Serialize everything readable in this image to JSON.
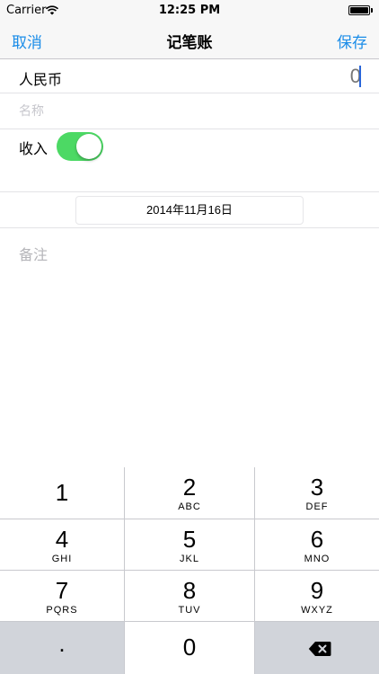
{
  "status_bar": {
    "carrier": "Carrier",
    "time": "12:25 PM",
    "icons": [
      "wifi-icon",
      "battery-icon"
    ]
  },
  "nav": {
    "cancel_label": "取消",
    "title": "记笔账",
    "save_label": "保存",
    "accent_color": "#1a8ce8"
  },
  "form": {
    "currency_label": "人民币",
    "amount_value": "0",
    "name_placeholder": "名称",
    "income_label": "收入",
    "income_toggle_on": true,
    "toggle_color": "#4cd964",
    "date_label": "2014年11月16日",
    "notes_placeholder": "备注"
  },
  "keypad": {
    "keys": [
      {
        "digit": "1",
        "letters": ""
      },
      {
        "digit": "2",
        "letters": "ABC"
      },
      {
        "digit": "3",
        "letters": "DEF"
      },
      {
        "digit": "4",
        "letters": "GHI"
      },
      {
        "digit": "5",
        "letters": "JKL"
      },
      {
        "digit": "6",
        "letters": "MNO"
      },
      {
        "digit": "7",
        "letters": "PQRS"
      },
      {
        "digit": "8",
        "letters": "TUV"
      },
      {
        "digit": "9",
        "letters": "WXYZ"
      }
    ],
    "decimal_label": ".",
    "zero_label": "0",
    "delete_icon": "backspace-icon"
  }
}
